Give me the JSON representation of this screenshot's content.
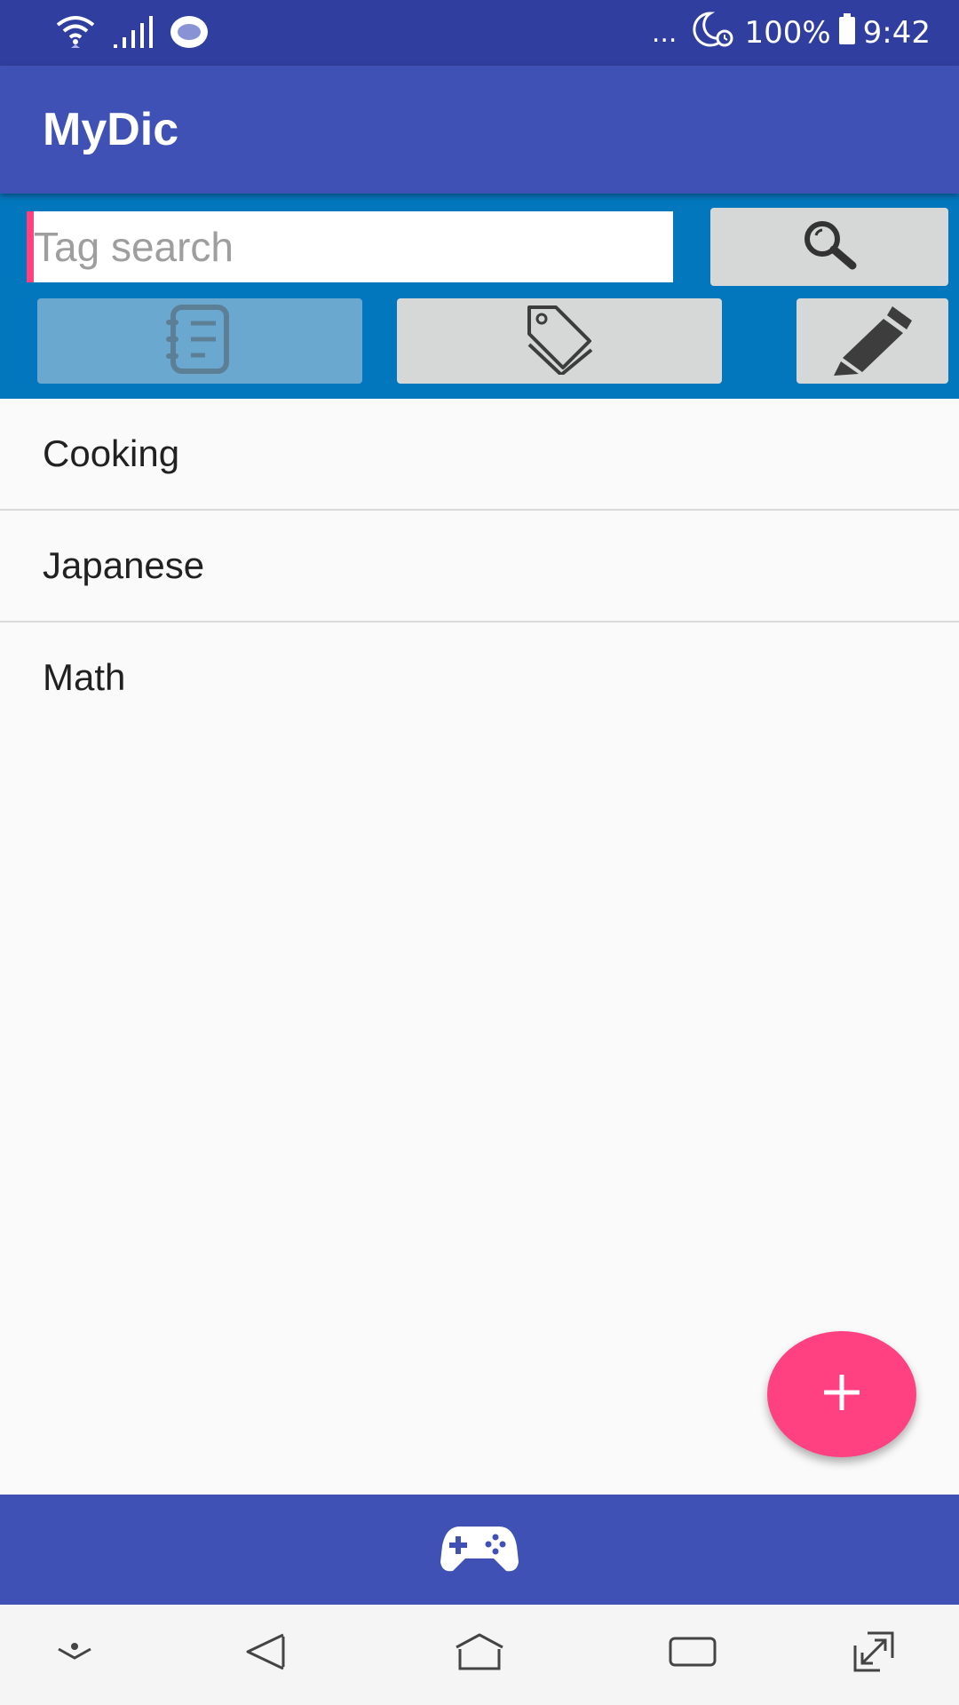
{
  "status_bar": {
    "dots": "...",
    "battery": "100%",
    "time": "9:42",
    "icons": [
      "wifi-icon",
      "signal-icon",
      "eye-icon",
      "moon-icon",
      "alarm-icon",
      "battery-icon"
    ]
  },
  "app_bar": {
    "title": "MyDic"
  },
  "search": {
    "placeholder": "Tag search",
    "value": "",
    "button_icon": "search-icon"
  },
  "tool_buttons": [
    {
      "icon": "notebook-icon",
      "active": true
    },
    {
      "icon": "tags-icon",
      "active": false
    },
    {
      "icon": "pencil-icon",
      "active": false
    }
  ],
  "tags": [
    {
      "label": "Cooking"
    },
    {
      "label": "Japanese"
    },
    {
      "label": "Math"
    }
  ],
  "fab": {
    "icon": "plus-icon"
  },
  "bottom_bar": {
    "icon": "gamepad-icon"
  },
  "nav_bar": {
    "icons": [
      "hide-keyboard-icon",
      "back-icon",
      "home-icon",
      "recents-icon",
      "expand-icon"
    ]
  },
  "colors": {
    "status_bar": "#303f9f",
    "app_bar": "#3f51b5",
    "toolbar": "#0277bd",
    "accent": "#ff4081",
    "button": "#d6d7d7",
    "button_active": "#6aa8d0"
  }
}
